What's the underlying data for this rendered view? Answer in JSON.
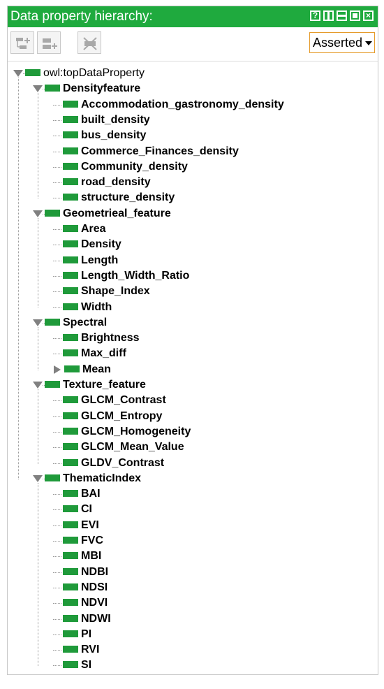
{
  "window": {
    "title": "Data property hierarchy:",
    "controls": [
      "help-icon",
      "split-icon",
      "minimize-icon",
      "maximize-icon",
      "close-icon"
    ],
    "accent_color": "#1faa3e"
  },
  "toolbar": {
    "buttons": [
      "add-sub-property-icon",
      "add-sibling-property-icon",
      "delete-property-icon"
    ],
    "view_select": "Asserted"
  },
  "tree": {
    "root": "owl:topDataProperty",
    "groups": [
      {
        "label": "Densityfeature",
        "children": [
          {
            "label": "Accommodation_gastronomy_density"
          },
          {
            "label": "built_density"
          },
          {
            "label": "bus_density"
          },
          {
            "label": "Commerce_Finances_density"
          },
          {
            "label": "Community_density"
          },
          {
            "label": "road_density"
          },
          {
            "label": "structure_density"
          }
        ]
      },
      {
        "label": "Geometrieal_feature",
        "children": [
          {
            "label": "Area"
          },
          {
            "label": "Density"
          },
          {
            "label": "Length"
          },
          {
            "label": "Length_Width_Ratio"
          },
          {
            "label": "Shape_Index"
          },
          {
            "label": "Width"
          }
        ]
      },
      {
        "label": "Spectral",
        "children": [
          {
            "label": "Brightness"
          },
          {
            "label": "Max_diff"
          },
          {
            "label": "Mean",
            "collapsed": true
          }
        ]
      },
      {
        "label": "Texture_feature",
        "children": [
          {
            "label": "GLCM_Contrast"
          },
          {
            "label": "GLCM_Entropy"
          },
          {
            "label": "GLCM_Homogeneity"
          },
          {
            "label": "GLCM_Mean_Value"
          },
          {
            "label": "GLDV_Contrast"
          }
        ]
      },
      {
        "label": "ThematicIndex",
        "children": [
          {
            "label": "BAI"
          },
          {
            "label": "CI"
          },
          {
            "label": "EVI"
          },
          {
            "label": "FVC"
          },
          {
            "label": "MBI"
          },
          {
            "label": "NDBI"
          },
          {
            "label": "NDSI"
          },
          {
            "label": "NDVI"
          },
          {
            "label": "NDWI"
          },
          {
            "label": "PI"
          },
          {
            "label": "RVI"
          },
          {
            "label": "SI"
          }
        ]
      }
    ]
  }
}
